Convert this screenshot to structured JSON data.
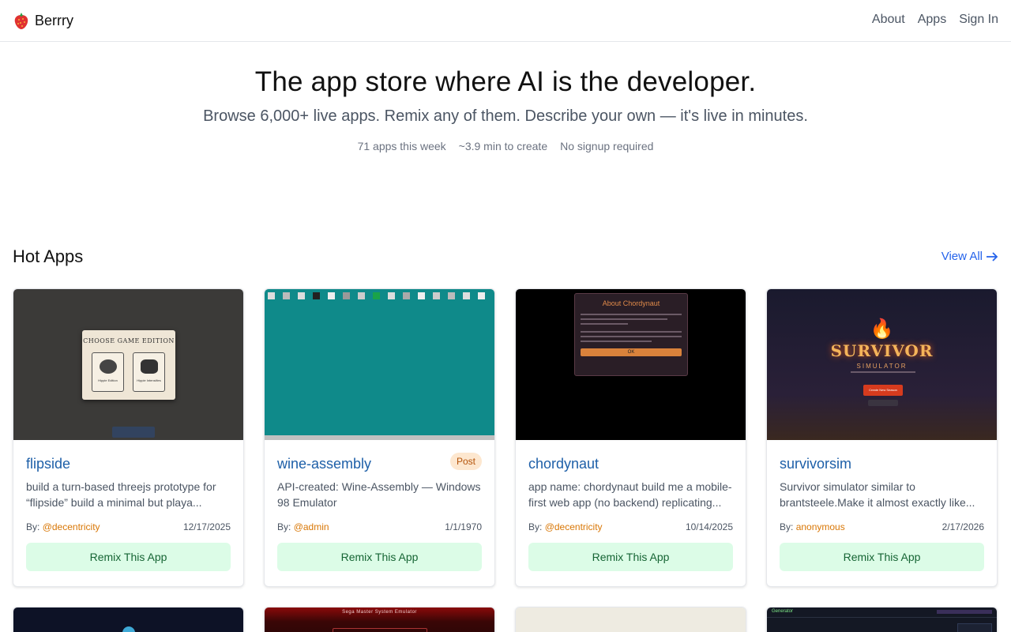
{
  "header": {
    "brand": "Berrry",
    "nav": [
      "About",
      "Apps",
      "Sign In"
    ]
  },
  "hero": {
    "title": "The app store where AI is the developer.",
    "subtitle": "Browse 6,000+ live apps. Remix any of them. Describe your own — it's live in minutes.",
    "stats": [
      "71 apps this week",
      "~3.9 min to create",
      "No signup required"
    ]
  },
  "section": {
    "title": "Hot Apps",
    "view_all": "View All"
  },
  "cards": [
    {
      "name": "flipside",
      "description": "build a turn-based threejs prototype for “flipside” build a minimal but playa...",
      "by_label": "By:",
      "author": "@decentricity",
      "date": "12/17/2025",
      "remix": "Remix This App",
      "thumb_title": "CHOOSE GAME EDITION",
      "thumb_opt1": "Hippie Edition",
      "thumb_opt2": "Hippie Intensifies"
    },
    {
      "name": "wine-assembly",
      "badge": "Post",
      "description": "API-created: Wine-Assembly — Windows 98 Emulator",
      "by_label": "By:",
      "author": "@admin",
      "date": "1/1/1970",
      "remix": "Remix This App"
    },
    {
      "name": "chordynaut",
      "description": "app name: chordynaut build me a mobile-first web app (no backend) replicating...",
      "by_label": "By:",
      "author": "@decentricity",
      "date": "10/14/2025",
      "remix": "Remix This App",
      "thumb_title": "About Chordynaut",
      "thumb_button": "OK"
    },
    {
      "name": "survivorsim",
      "description": "Survivor simulator similar to brantsteele.Make it almost exactly like...",
      "by_label": "By:",
      "author": "anonymous",
      "date": "2/17/2026",
      "remix": "Remix This App",
      "thumb_title": "SURVIVOR",
      "thumb_sub": "SIMULATOR",
      "thumb_button": "Create New Season"
    }
  ],
  "row2": {
    "thumb_text_2": "Sega Master System Emulator",
    "thumb_text_4": "Generator"
  },
  "colors": {
    "link": "#1d5fa8",
    "accent": "#2563eb",
    "remix_bg": "#dcfce7",
    "remix_text": "#166534",
    "author": "#d97706"
  }
}
